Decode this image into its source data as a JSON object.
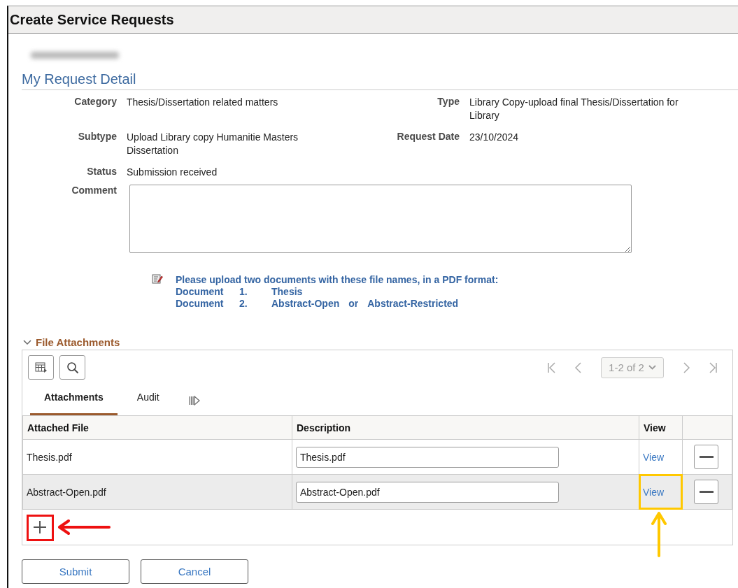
{
  "window": {
    "title": "Create Service Requests"
  },
  "user_name": {
    "redacted": true
  },
  "section_title": "My Request Detail",
  "fields": [
    {
      "label": "Category",
      "value": "Thesis/Dissertation related matters"
    },
    {
      "label": "Type",
      "value": "Library Copy-upload final Thesis/Dissertation for Library"
    },
    {
      "label": "Subtype",
      "value": "Upload Library copy Humanitie Masters Dissertation"
    },
    {
      "label": "Request Date",
      "value": "23/10/2024"
    },
    {
      "label": "Status",
      "value": "Submission received"
    }
  ],
  "comment": {
    "label": "Comment"
  },
  "instructions": {
    "heading": "Please upload two documents with these file names, in a PDF format:",
    "lines": [
      [
        "Document",
        "1.",
        "Thesis"
      ],
      [
        "Document",
        "2.",
        "Abstract-Open",
        "or",
        "Abstract-Restricted"
      ]
    ]
  },
  "attachments": {
    "title": "File Attachments",
    "expanded": true,
    "pager": {
      "range": "1-2 of 2"
    },
    "tabs": [
      {
        "label": "Attachments",
        "selected": true
      },
      {
        "label": "Audit",
        "selected": false
      }
    ],
    "columns": [
      "Attached File",
      "Description",
      "View"
    ],
    "rows": [
      {
        "file": "Thesis.pdf",
        "description": "Thesis.pdf",
        "view": "View",
        "selected": false,
        "highlighted": false
      },
      {
        "file": "Abstract-Open.pdf",
        "description": "Abstract-Open.pdf",
        "view": "View",
        "selected": true,
        "highlighted": true
      }
    ],
    "add_highlighted": true
  },
  "buttons": [
    "Submit",
    "Cancel"
  ]
}
